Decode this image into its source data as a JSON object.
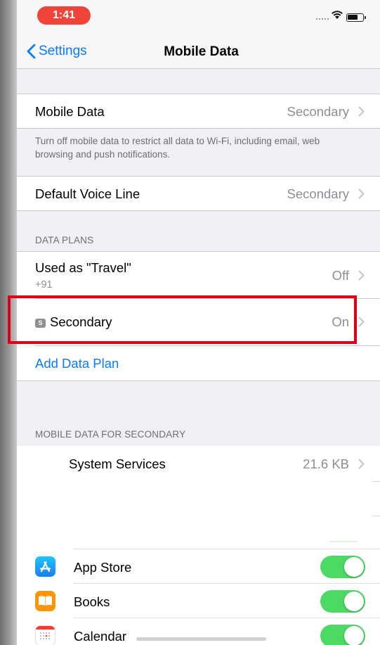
{
  "status_bar": {
    "time": "1:41"
  },
  "nav": {
    "back_label": "Settings",
    "title": "Mobile Data"
  },
  "mobile_data_row": {
    "label": "Mobile Data",
    "value": "Secondary"
  },
  "mobile_data_note": "Turn off mobile data to restrict all data to Wi-Fi, including email, web browsing and push notifications.",
  "voice_row": {
    "label": "Default Voice Line",
    "value": "Secondary"
  },
  "data_plans": {
    "header": "DATA PLANS",
    "plans": [
      {
        "label": "Used as \"Travel\"",
        "sublabel": "+91",
        "value": "Off"
      },
      {
        "badge": "S",
        "label": "Secondary",
        "value": "On"
      }
    ],
    "add_label": "Add Data Plan"
  },
  "usage_section": {
    "header": "MOBILE DATA FOR SECONDARY",
    "system_services": {
      "label": "System Services",
      "value": "21.6 KB"
    }
  },
  "apps": [
    {
      "name": "App Store",
      "icon": "app-store-icon",
      "enabled": true
    },
    {
      "name": "Books",
      "icon": "books-icon",
      "enabled": true
    },
    {
      "name": "Calendar",
      "icon": "calendar-icon",
      "enabled": true
    }
  ],
  "colors": {
    "accent": "#0a7aff",
    "toggle_on": "#4cd964",
    "time_pill": "#f0433a",
    "highlight": "#e00015"
  }
}
